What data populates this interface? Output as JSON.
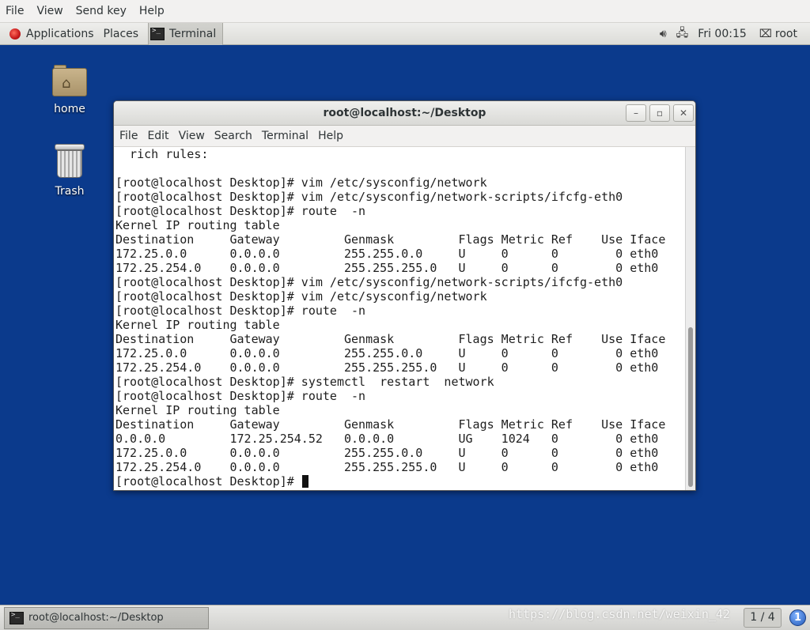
{
  "viewer_menu": [
    "File",
    "View",
    "Send key",
    "Help"
  ],
  "top_panel": {
    "applications_label": "Applications",
    "places_label": "Places",
    "task_label": "Terminal",
    "clock": "Fri 00:15",
    "user": "root",
    "icons": [
      "volume-icon",
      "network-icon",
      "user-icon"
    ]
  },
  "desktop_icons": [
    {
      "label": "home",
      "icon": "home-folder-icon"
    },
    {
      "label": "Trash",
      "icon": "trash-icon"
    }
  ],
  "terminal": {
    "title": "root@localhost:~/Desktop",
    "menu": [
      "File",
      "Edit",
      "View",
      "Search",
      "Terminal",
      "Help"
    ],
    "lines": [
      "  rich rules: ",
      "",
      "[root@localhost Desktop]# vim /etc/sysconfig/network",
      "[root@localhost Desktop]# vim /etc/sysconfig/network-scripts/ifcfg-eth0",
      "[root@localhost Desktop]# route  -n",
      "Kernel IP routing table",
      "Destination     Gateway         Genmask         Flags Metric Ref    Use Iface",
      "172.25.0.0      0.0.0.0         255.255.0.0     U     0      0        0 eth0",
      "172.25.254.0    0.0.0.0         255.255.255.0   U     0      0        0 eth0",
      "[root@localhost Desktop]# vim /etc/sysconfig/network-scripts/ifcfg-eth0",
      "[root@localhost Desktop]# vim /etc/sysconfig/network",
      "[root@localhost Desktop]# route  -n",
      "Kernel IP routing table",
      "Destination     Gateway         Genmask         Flags Metric Ref    Use Iface",
      "172.25.0.0      0.0.0.0         255.255.0.0     U     0      0        0 eth0",
      "172.25.254.0    0.0.0.0         255.255.255.0   U     0      0        0 eth0",
      "[root@localhost Desktop]# systemctl  restart  network",
      "[root@localhost Desktop]# route  -n",
      "Kernel IP routing table",
      "Destination     Gateway         Genmask         Flags Metric Ref    Use Iface",
      "0.0.0.0         172.25.254.52   0.0.0.0         UG    1024   0        0 eth0",
      "172.25.0.0      0.0.0.0         255.255.0.0     U     0      0        0 eth0",
      "172.25.254.0    0.0.0.0         255.255.255.0   U     0      0        0 eth0"
    ],
    "prompt": "[root@localhost Desktop]# "
  },
  "bottom_panel": {
    "task_label": "root@localhost:~/Desktop",
    "workspace": "1 / 4",
    "watermark": "https://blog.csdn.net/weixin_42"
  }
}
